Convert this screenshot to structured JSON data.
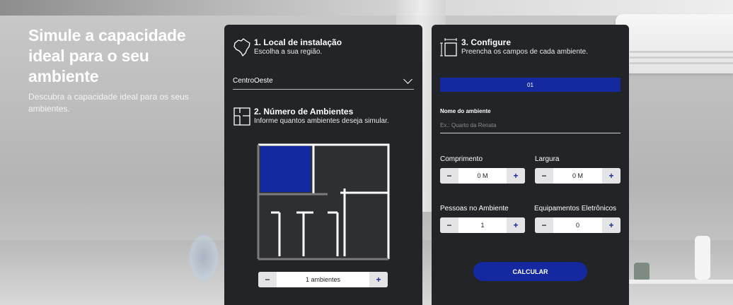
{
  "hero": {
    "title": "Simule a capacidade ideal para o seu ambiente",
    "subtitle": "Descubra a capacidade ideal para os seus ambientes."
  },
  "step1": {
    "title": "1. Local de instalação",
    "description": "Escolha a sua região.",
    "icon": "brazil-map-icon",
    "region_value": "CentroOeste"
  },
  "step2": {
    "title": "2. Número de Ambientes",
    "description": "Informe quantos ambientes deseja simular.",
    "icon": "floor-plan-icon",
    "rooms_value": "1 ambientes",
    "minus": "−",
    "plus": "+"
  },
  "step3": {
    "title": "3. Configure",
    "description": "Preencha os campos de cada ambiente.",
    "icon": "dimensions-icon",
    "room_tab": "01",
    "name_label": "Nome do ambiente",
    "name_placeholder": "Ex.: Quarto da Renata",
    "length_label": "Comprimento",
    "length_value": "0 M",
    "width_label": "Largura",
    "width_value": "0 M",
    "people_label": "Pessoas no Ambiente",
    "people_value": "1",
    "devices_label": "Equipamentos Eletrônicos",
    "devices_value": "0",
    "minus": "−",
    "plus": "+",
    "calculate": "CALCULAR"
  },
  "colors": {
    "accent": "#1428a0",
    "panel": "#222428"
  }
}
